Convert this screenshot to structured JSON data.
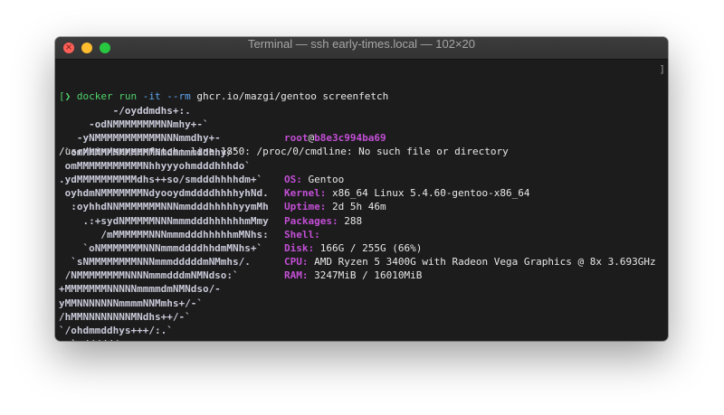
{
  "window": {
    "title": "Terminal — ssh early-times.local — 102×20"
  },
  "prompt": {
    "bracket": "[",
    "arrow": "❯",
    "command": "docker",
    "subcommand": "run",
    "flags": "-it --rm",
    "args": "ghcr.io/mazgi/gentoo screenfetch",
    "right_bracket": "]"
  },
  "error_line": "/usr/bin/screenfetch: line 1850: /proc/0/cmdline: No such file or directory",
  "ascii_logo": [
    "         -/oyddmdhs+:.",
    "     -odNMMMMMMMMNNmhy+-`",
    "   -yNMMMMMMMMMMMNNNmmdhy+-",
    " `omMMMMMMMMMMMMNmdmmmmddhhy/`",
    " omMMMMMMMMMMMNhhyyyohmdddhhhdo`",
    ".ydMMMMMMMMMMdhs++so/smdddhhhhdm+`",
    " oyhdmNMMMMMMMNdyooydmddddhhhhyhNd.",
    "  :oyhhdNNMMMMMMMNNNmmdddhhhhhyymMh",
    "    .:+sydNMMMMMNNNmmmdddhhhhhhmMmy",
    "       /mMMMMMMNNNmmmdddhhhhhmMNhs:",
    "    `oNMMMMMMMNNNmmmddddhhdmMNhs+`",
    "  `sNMMMMMMMMNNNmmmdddddmNMmhs/.",
    " /NMMMMMMMMNNNNmmmdddmNMNdso:`",
    "+MMMMMMMNNNNNmmmmdmNMNdso/-",
    "yMMNNNNNNNmmmmNNMmhs+/-`",
    "/hMMNNNNNNNNMNdhs++/-`",
    "`/ohdmmddhys+++/:.`",
    "  `-//////:--."
  ],
  "info": {
    "user": "root",
    "at": "@",
    "host": "b8e3c994ba69",
    "rows": [
      {
        "label": "OS:",
        "value": "Gentoo"
      },
      {
        "label": "Kernel:",
        "value": "x86_64 Linux 5.4.60-gentoo-x86_64"
      },
      {
        "label": "Uptime:",
        "value": "2d 5h 46m"
      },
      {
        "label": "Packages:",
        "value": "288"
      },
      {
        "label": "Shell:",
        "value": ""
      },
      {
        "label": "Disk:",
        "value": "166G / 255G (66%)"
      },
      {
        "label": "CPU:",
        "value": "AMD Ryzen 5 3400G with Radeon Vega Graphics @ 8x 3.693GHz"
      },
      {
        "label": "RAM:",
        "value": "3247MiB / 16010MiB"
      }
    ]
  }
}
